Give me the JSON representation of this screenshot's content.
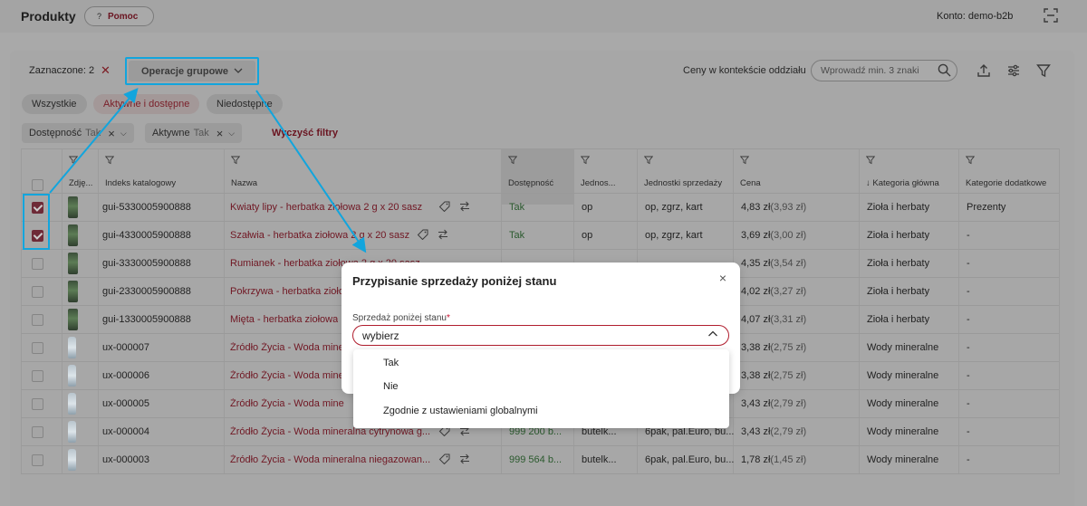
{
  "header": {
    "title": "Produkty",
    "help_label": "Pomoc",
    "help_glyph": "?",
    "account": "Konto: demo-b2b"
  },
  "toolbar": {
    "selected": "Zaznaczone: 2",
    "clear_glyph": "✕",
    "group_ops": "Operacje grupowe",
    "prices_label": "Ceny w kontekście oddziału",
    "search_placeholder": "Wprowadź min. 3 znaki"
  },
  "quick_filters": [
    "Wszystkie",
    "Aktywne i dostępne",
    "Niedostępne"
  ],
  "active_filters": [
    {
      "label": "Dostępność",
      "value": "Tak"
    },
    {
      "label": "Aktywne",
      "value": "Tak"
    }
  ],
  "clear_filters": "Wyczyść filtry",
  "table": {
    "columns": [
      "Zdję...",
      "Indeks katalogowy",
      "Nazwa",
      "Dostępność",
      "Jednos...",
      "Jednostki sprzedaży",
      "Cena",
      "↓ Kategoria główna",
      "Kategorie dodatkowe"
    ],
    "rows": [
      {
        "checked": true,
        "img": "tea",
        "index": "gui-5330005900888",
        "name": "Kwiaty lipy - herbatka ziołowa 2 g x 20 sasz",
        "avail": "Tak",
        "unit": "op",
        "units": "op, zgrz, kart",
        "price": "4,83 zł",
        "price_net": "(3,93 zł)",
        "category": "Zioła i herbaty",
        "extra": "Prezenty"
      },
      {
        "checked": true,
        "img": "tea",
        "index": "gui-4330005900888",
        "name": "Szałwia - herbatka ziołowa 2 g x 20 sasz",
        "avail": "Tak",
        "unit": "op",
        "units": "op, zgrz, kart",
        "price": "3,69 zł",
        "price_net": "(3,00 zł)",
        "category": "Zioła i herbaty",
        "extra": "-"
      },
      {
        "checked": false,
        "img": "tea",
        "index": "gui-3330005900888",
        "name": "Rumianek - herbatka ziołowa 2 g x 20 sasz",
        "avail": "",
        "unit": "",
        "units": "",
        "price": "4,35 zł",
        "price_net": "(3,54 zł)",
        "category": "Zioła i herbaty",
        "extra": "-"
      },
      {
        "checked": false,
        "img": "tea",
        "index": "gui-2330005900888",
        "name": "Pokrzywa - herbatka ziołowa",
        "avail": "",
        "unit": "",
        "units": "",
        "price": "4,02 zł",
        "price_net": "(3,27 zł)",
        "category": "Zioła i herbaty",
        "extra": "-"
      },
      {
        "checked": false,
        "img": "tea",
        "index": "gui-1330005900888",
        "name": "Mięta - herbatka ziołowa",
        "avail": "",
        "unit": "",
        "units": "",
        "price": "4,07 zł",
        "price_net": "(3,31 zł)",
        "category": "Zioła i herbaty",
        "extra": "-"
      },
      {
        "checked": false,
        "img": "water",
        "index": "ux-000007",
        "name": "Źródło Życia - Woda mine",
        "avail": "",
        "unit": "",
        "units": "",
        "price": "3,38 zł",
        "price_net": "(2,75 zł)",
        "category": "Wody mineralne",
        "extra": "-"
      },
      {
        "checked": false,
        "img": "water",
        "index": "ux-000006",
        "name": "Źródło Życia - Woda mine",
        "avail": "",
        "unit": "",
        "units": "",
        "price": "3,38 zł",
        "price_net": "(2,75 zł)",
        "category": "Wody mineralne",
        "extra": "-"
      },
      {
        "checked": false,
        "img": "water",
        "index": "ux-000005",
        "name": "Źródło Życia - Woda mine",
        "avail": "",
        "unit": "",
        "units": "",
        "price": "3,43 zł",
        "price_net": "(2,79 zł)",
        "category": "Wody mineralne",
        "extra": "-"
      },
      {
        "checked": false,
        "img": "water",
        "index": "ux-000004",
        "name": "Źródło Życia - Woda mineralna cytrynowa g...",
        "avail": "999 200 b...",
        "unit": "butelk...",
        "units": "6pak, pal.Euro, bu...",
        "price": "3,43 zł",
        "price_net": "(2,79 zł)",
        "category": "Wody mineralne",
        "extra": "-"
      },
      {
        "checked": false,
        "img": "water",
        "index": "ux-000003",
        "name": "Źródło Życia - Woda mineralna niegazowan...",
        "avail": "999 564 b...",
        "unit": "butelk...",
        "units": "6pak, pal.Euro, bu...",
        "price": "1,78 zł",
        "price_net": "(1,45 zł)",
        "category": "Wody mineralne",
        "extra": "-"
      }
    ]
  },
  "modal": {
    "title": "Przypisanie sprzedaży poniżej stanu",
    "close_glyph": "×",
    "field_label": "Sprzedaż poniżej stanu",
    "required_mark": "*",
    "select_value": "wybierz",
    "options": [
      "Tak",
      "Nie",
      "Zgodnie z ustawieniami globalnymi"
    ]
  },
  "colors": {
    "accent": "#12a5dd",
    "brand": "#b01e2e",
    "link": "#701723",
    "available": "#2b5a2e"
  }
}
